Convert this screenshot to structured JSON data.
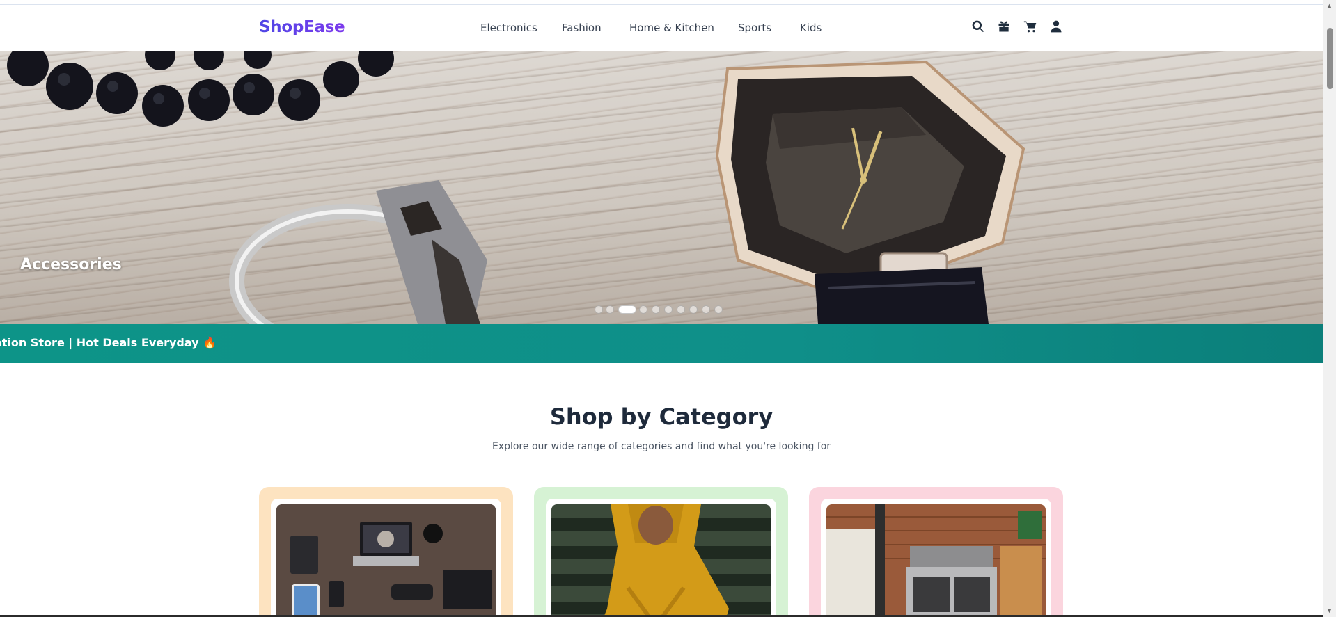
{
  "brand": {
    "name": "ShopEase",
    "gradient": [
      "#4f46e5",
      "#7c3aed"
    ]
  },
  "nav": {
    "links": [
      {
        "label": "Electronics"
      },
      {
        "label": "Fashion"
      },
      {
        "label": "Home & Kitchen"
      },
      {
        "label": "Sports"
      },
      {
        "label": "Kids"
      }
    ],
    "icons": [
      "search-icon",
      "gift-box-icon",
      "cart-icon",
      "user-icon"
    ]
  },
  "hero": {
    "slide_title": "Accessories",
    "slide_count": 10,
    "active_slide": 3
  },
  "ticker": {
    "text": "ation Store | Hot Deals Everyday",
    "emoji": "🔥",
    "color": "#0d9488"
  },
  "categories": {
    "title": "Shop by Category",
    "subtitle": "Explore our wide range of categories and find what you're looking for",
    "cards": [
      {
        "image": "electronics-desk-photo",
        "bg": "#fde3c0"
      },
      {
        "image": "fashion-yellow-dress-photo",
        "bg": "#d6f2d4"
      },
      {
        "image": "home-kitchen-stove-photo",
        "bg": "#fbd5de"
      }
    ]
  }
}
